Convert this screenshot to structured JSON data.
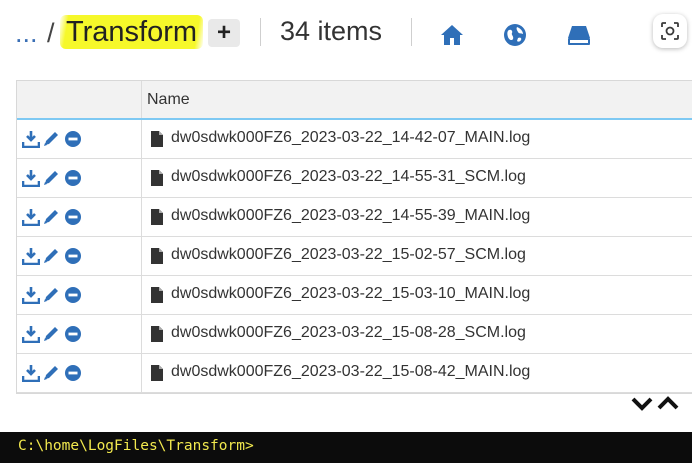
{
  "header": {
    "ellipsis": "...",
    "separator": "/",
    "current_folder": "Transform",
    "add_label": "+",
    "item_count": "34 items",
    "icons": [
      "home-icon",
      "globe-icon",
      "drive-icon",
      "screen-capture-icon"
    ]
  },
  "table": {
    "columns": [
      "",
      "Name"
    ],
    "row_actions": [
      "download-icon",
      "edit-icon",
      "delete-icon"
    ],
    "rows": [
      {
        "name": "dw0sdwk000FZ6_2023-03-22_14-42-07_MAIN.log"
      },
      {
        "name": "dw0sdwk000FZ6_2023-03-22_14-55-31_SCM.log"
      },
      {
        "name": "dw0sdwk000FZ6_2023-03-22_14-55-39_MAIN.log"
      },
      {
        "name": "dw0sdwk000FZ6_2023-03-22_15-02-57_SCM.log"
      },
      {
        "name": "dw0sdwk000FZ6_2023-03-22_15-03-10_MAIN.log"
      },
      {
        "name": "dw0sdwk000FZ6_2023-03-22_15-08-28_SCM.log"
      },
      {
        "name": "dw0sdwk000FZ6_2023-03-22_15-08-42_MAIN.log"
      }
    ]
  },
  "console": {
    "prompt": "C:\\home\\LogFiles\\Transform>"
  },
  "colors": {
    "accent": "#2f6fb8",
    "highlight": "#f6f82a",
    "console_bg": "#0c0c0c",
    "console_text": "#f2e94e"
  }
}
